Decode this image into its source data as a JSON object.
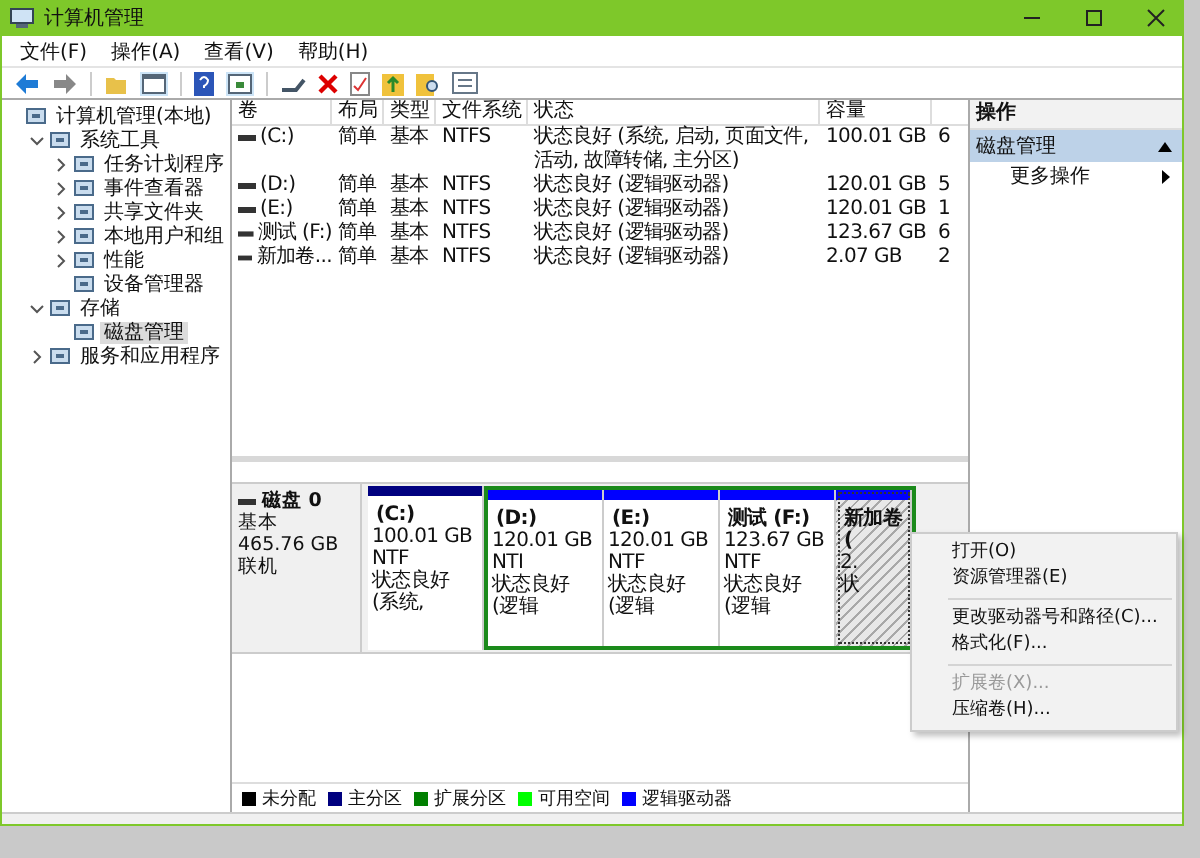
{
  "window": {
    "title": "计算机管理"
  },
  "menu": [
    "文件(F)",
    "操作(A)",
    "查看(V)",
    "帮助(H)"
  ],
  "tree": [
    {
      "label": "计算机管理(本地)",
      "selected": false,
      "children": [
        {
          "label": "系统工具",
          "expanded": true,
          "selected": false,
          "children": [
            {
              "label": "任务计划程序",
              "expanded": false,
              "selected": false
            },
            {
              "label": "事件查看器",
              "expanded": false,
              "selected": false
            },
            {
              "label": "共享文件夹",
              "expanded": false,
              "selected": false
            },
            {
              "label": "本地用户和组",
              "expanded": false,
              "selected": false
            },
            {
              "label": "性能",
              "expanded": false,
              "selected": false
            },
            {
              "label": "设备管理器",
              "selected": false
            }
          ]
        },
        {
          "label": "存储",
          "expanded": true,
          "selected": false,
          "children": [
            {
              "label": "磁盘管理",
              "selected": true
            }
          ]
        },
        {
          "label": "服务和应用程序",
          "expanded": false,
          "selected": false
        }
      ]
    }
  ],
  "table": {
    "columns": [
      "卷",
      "布局",
      "类型",
      "文件系统",
      "状态",
      "容量"
    ],
    "rows": [
      [
        "(C:)",
        "简单",
        "基本",
        "NTFS",
        "状态良好 (系统, 启动, 页面文件, 活动, 故障转储, 主分区)",
        "100.01 GB",
        "6"
      ],
      [
        "(D:)",
        "简单",
        "基本",
        "NTFS",
        "状态良好 (逻辑驱动器)",
        "120.01 GB",
        "5"
      ],
      [
        "(E:)",
        "简单",
        "基本",
        "NTFS",
        "状态良好 (逻辑驱动器)",
        "120.01 GB",
        "1"
      ],
      [
        "测试 (F:)",
        "简单",
        "基本",
        "NTFS",
        "状态良好 (逻辑驱动器)",
        "123.67 GB",
        "6"
      ],
      [
        "新加卷...",
        "简单",
        "基本",
        "NTFS",
        "状态良好 (逻辑驱动器)",
        "2.07 GB",
        "2"
      ]
    ]
  },
  "disk": {
    "name": "磁盘 0",
    "type": "基本",
    "size": "465.76 GB",
    "status": "联机",
    "partitions": [
      {
        "kind": "primary",
        "name": "(C:)",
        "size": "100.01 GB NTF",
        "status": "状态良好 (系统,",
        "selected": false
      },
      {
        "kind": "logical",
        "name": "(D:)",
        "size": "120.01 GB NTI",
        "status": "状态良好 (逻辑",
        "selected": false
      },
      {
        "kind": "logical",
        "name": "(E:)",
        "size": "120.01 GB NTF",
        "status": "状态良好 (逻辑",
        "selected": false
      },
      {
        "kind": "logical",
        "name": "测试  (F:)",
        "size": "123.67 GB NTF",
        "status": "状态良好 (逻辑",
        "selected": false
      },
      {
        "kind": "logical",
        "name": "新加卷 (",
        "size": "2.",
        "status": "状",
        "selected": true
      }
    ]
  },
  "legend": [
    {
      "label": "未分配",
      "color": "#000000"
    },
    {
      "label": "主分区",
      "color": "#00007f"
    },
    {
      "label": "扩展分区",
      "color": "#007f00"
    },
    {
      "label": "可用空间",
      "color": "#00ff00"
    },
    {
      "label": "逻辑驱动器",
      "color": "#0000ff"
    }
  ],
  "actions": {
    "title": "操作",
    "section": {
      "label": "磁盘管理",
      "expanded": true
    },
    "items": [
      "更多操作"
    ]
  },
  "context_menu": [
    {
      "kind": "item",
      "label": "打开(O)",
      "disabled": false
    },
    {
      "kind": "item",
      "label": "资源管理器(E)",
      "disabled": false
    },
    {
      "kind": "separator"
    },
    {
      "kind": "item",
      "label": "更改驱动器号和路径(C)...",
      "disabled": false
    },
    {
      "kind": "item",
      "label": "格式化(F)...",
      "disabled": false
    },
    {
      "kind": "separator"
    },
    {
      "kind": "item",
      "label": "扩展卷(X)...",
      "disabled": true
    },
    {
      "kind": "item",
      "label": "压缩卷(H)...",
      "disabled": false
    }
  ]
}
